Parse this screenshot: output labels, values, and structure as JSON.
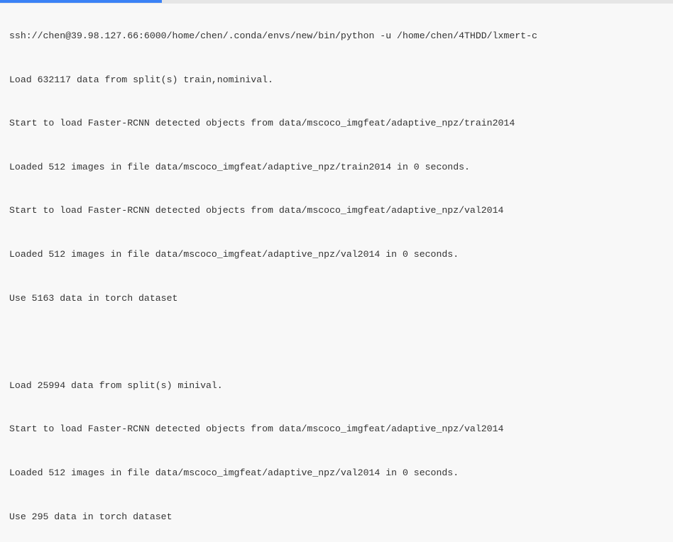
{
  "progress": {
    "percent": 24
  },
  "console": {
    "lines": [
      "ssh://chen@39.98.127.66:6000/home/chen/.conda/envs/new/bin/python -u /home/chen/4THDD/lxmert-c",
      "Load 632117 data from split(s) train,nominival.",
      "Start to load Faster-RCNN detected objects from data/mscoco_imgfeat/adaptive_npz/train2014",
      "Loaded 512 images in file data/mscoco_imgfeat/adaptive_npz/train2014 in 0 seconds.",
      "Start to load Faster-RCNN detected objects from data/mscoco_imgfeat/adaptive_npz/val2014",
      "Loaded 512 images in file data/mscoco_imgfeat/adaptive_npz/val2014 in 0 seconds.",
      "Use 5163 data in torch dataset",
      "",
      "Load 25994 data from split(s) minival.",
      "Start to load Faster-RCNN detected objects from data/mscoco_imgfeat/adaptive_npz/val2014",
      "Loaded 512 images in file data/mscoco_imgfeat/adaptive_npz/val2014 in 0 seconds.",
      "Use 295 data in torch dataset"
    ]
  }
}
